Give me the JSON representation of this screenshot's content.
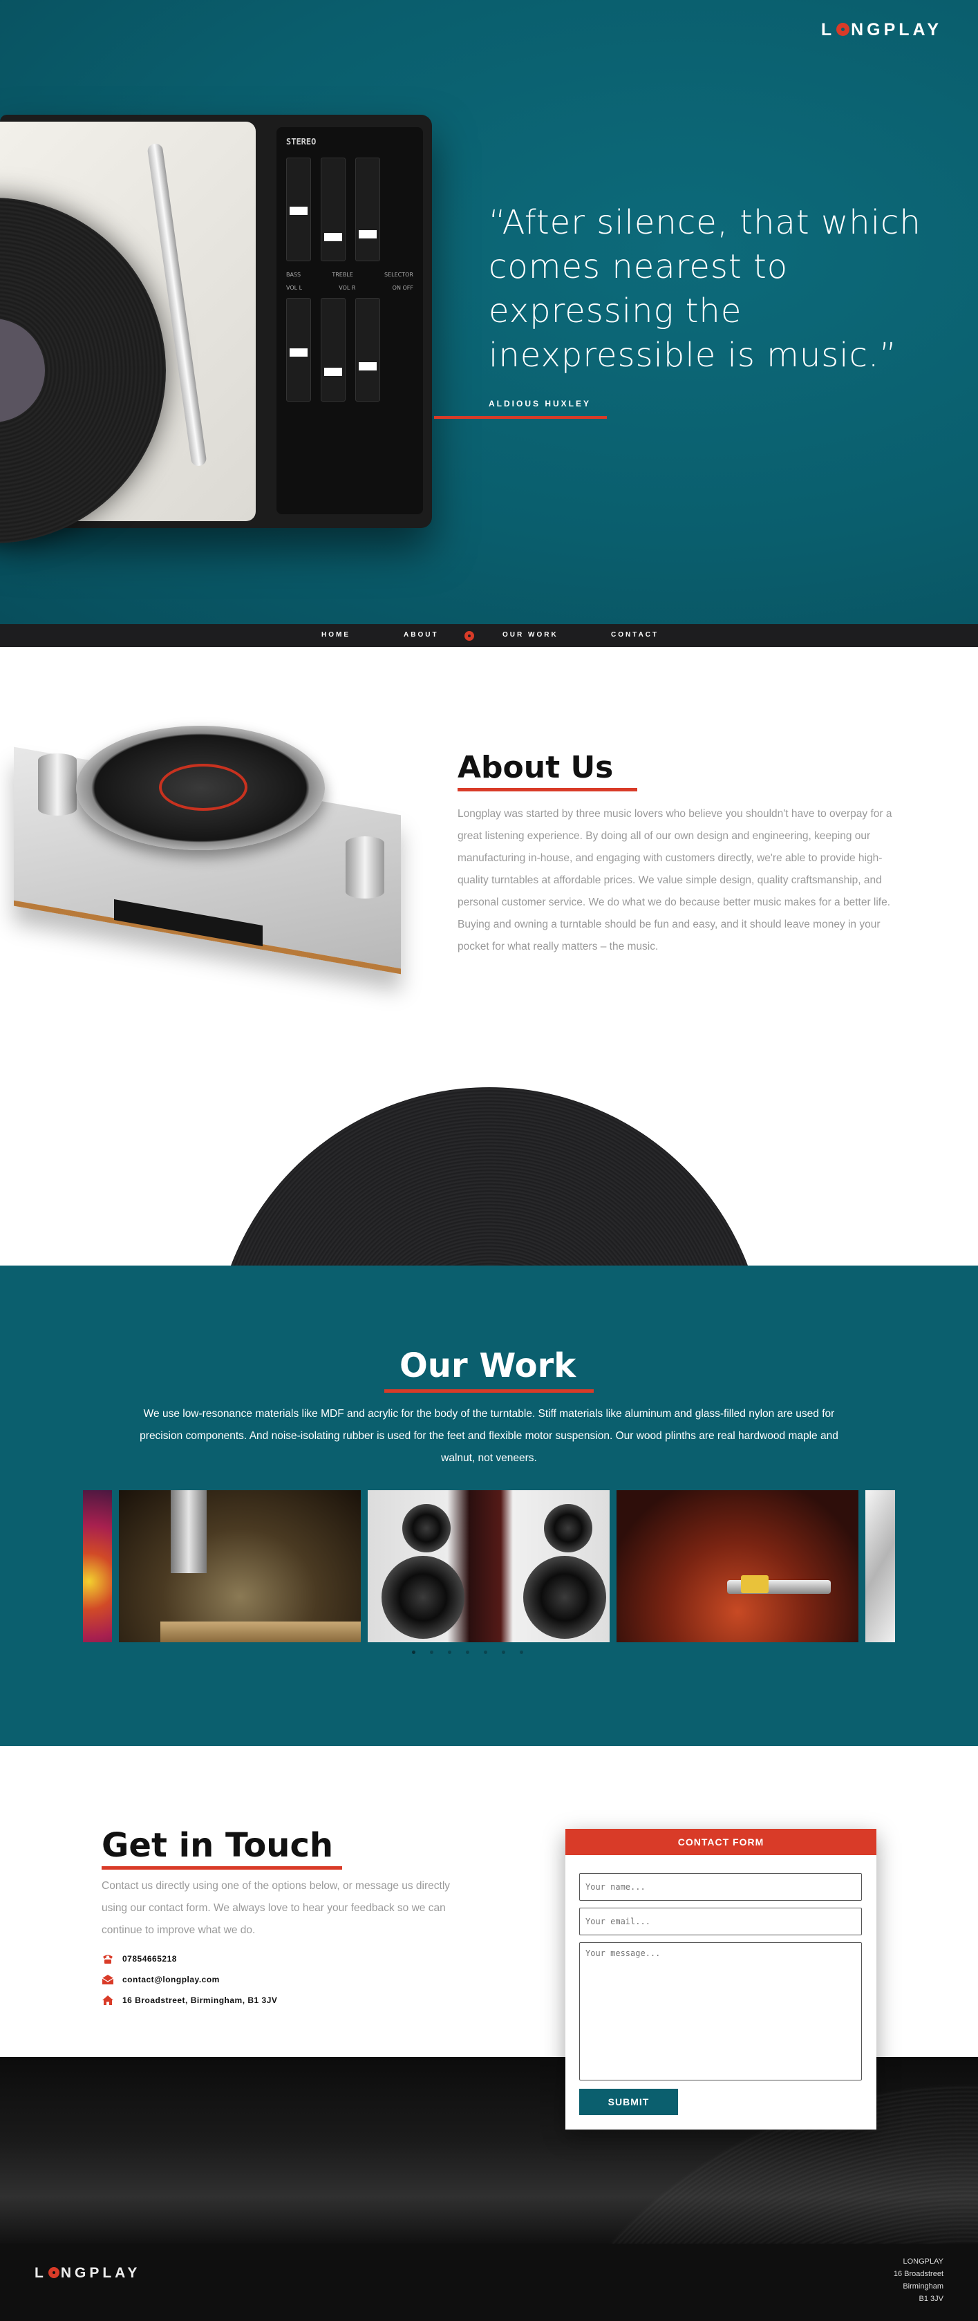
{
  "brand": {
    "logo_pre": "L",
    "logo_post": "NGPLAY"
  },
  "hero": {
    "quote": "“After silence, that which comes nearest to expressing the inexpressible is music.”",
    "author": "ALDIOUS HUXLEY",
    "console_label": "STEREO",
    "knob_labels_top": [
      "BASS",
      "TREBLE",
      "SELECTOR"
    ],
    "knob_labels_mid": [
      "VOL L",
      "VOL R",
      "ON OFF"
    ]
  },
  "nav": {
    "items": [
      "HOME",
      "ABOUT",
      "OUR WORK",
      "CONTACT"
    ]
  },
  "about": {
    "title": "About Us",
    "text": "Longplay was started by three music lovers who believe you shouldn't have to overpay for a great listening experience. By doing all of our own design and engineering, keeping our manufacturing in-house, and engaging with customers directly, we're able to provide high-quality turntables at affordable prices. We value simple design, quality craftsmanship, and personal customer service. We do what we do because better music makes for a better life. Buying and owning a turntable should be fun and easy, and it should leave money in your pocket for what really matters – the music."
  },
  "work": {
    "title": "Our Work",
    "text": "We use low-resonance materials like MDF and acrylic for the body of the turntable. Stiff materials like aluminum and glass-filled nylon are used for precision components. And noise-isolating rubber is used for the feet and flexible motor suspension. Our wood plinths are real hardwood maple and walnut, not veneers.",
    "slide_count": 7,
    "active_slide": 1
  },
  "contact": {
    "title": "Get in Touch",
    "text": "Contact us directly using one of the options below, or message us directly using our contact form. We always love to hear your feedback so we can continue to improve what we do.",
    "phone": "07854665218",
    "email": "contact@longplay.com",
    "address": "16 Broadstreet, Birmingham, B1 3JV"
  },
  "form": {
    "title": "CONTACT FORM",
    "name_placeholder": "Your name...",
    "email_placeholder": "Your email...",
    "message_placeholder": "Your message...",
    "submit_label": "SUBMIT"
  },
  "footer": {
    "address_lines": [
      "LONGPLAY",
      "16 Broadstreet",
      "Birmingham",
      "B1 3JV"
    ]
  },
  "colors": {
    "accent": "#d93b28",
    "teal": "#0b5f6e",
    "dark": "#1d1d1f"
  }
}
